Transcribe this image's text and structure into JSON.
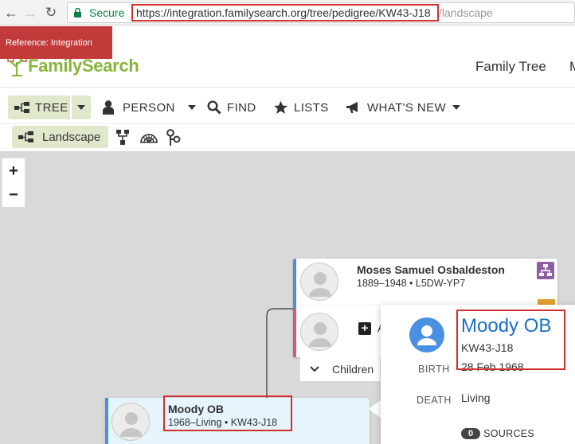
{
  "browser": {
    "secure_label": "Secure",
    "url_main": "https://integration.familysearch.org/tree/pedigree/KW43-J18",
    "url_tail": "/landscape"
  },
  "header": {
    "reference_banner": "Reference: Integration",
    "logo_text": "FamilySearch",
    "nav_family_tree": "Family Tree",
    "nav_cut": "M"
  },
  "toolbar": {
    "tree": "TREE",
    "person": "PERSON",
    "find": "FIND",
    "lists": "LISTS",
    "whats_new": "WHAT'S NEW"
  },
  "subtoolbar": {
    "landscape": "Landscape"
  },
  "zoom": {
    "in": "+",
    "out": "−"
  },
  "cards": {
    "father": {
      "name": "Moses Samuel Osbaldeston",
      "info": "1889–1948 • L5DW-YP7"
    },
    "add_label": "A",
    "children_label": "Children",
    "focus": {
      "name": "Moody OB",
      "info": "1968–Living • KW43-J18"
    }
  },
  "popup": {
    "name": "Moody OB",
    "id": "KW43-J18",
    "birth_label": "BIRTH",
    "birth_value": "28 Feb 1968",
    "death_label": "DEATH",
    "death_value": "Living",
    "sources_count": "0",
    "sources_label": "SOURCES"
  },
  "colors": {
    "brand_green": "#87b43a",
    "highlight_red": "#d32f2f",
    "male_blue": "#4a90e2",
    "female_pink": "#d9538a"
  }
}
